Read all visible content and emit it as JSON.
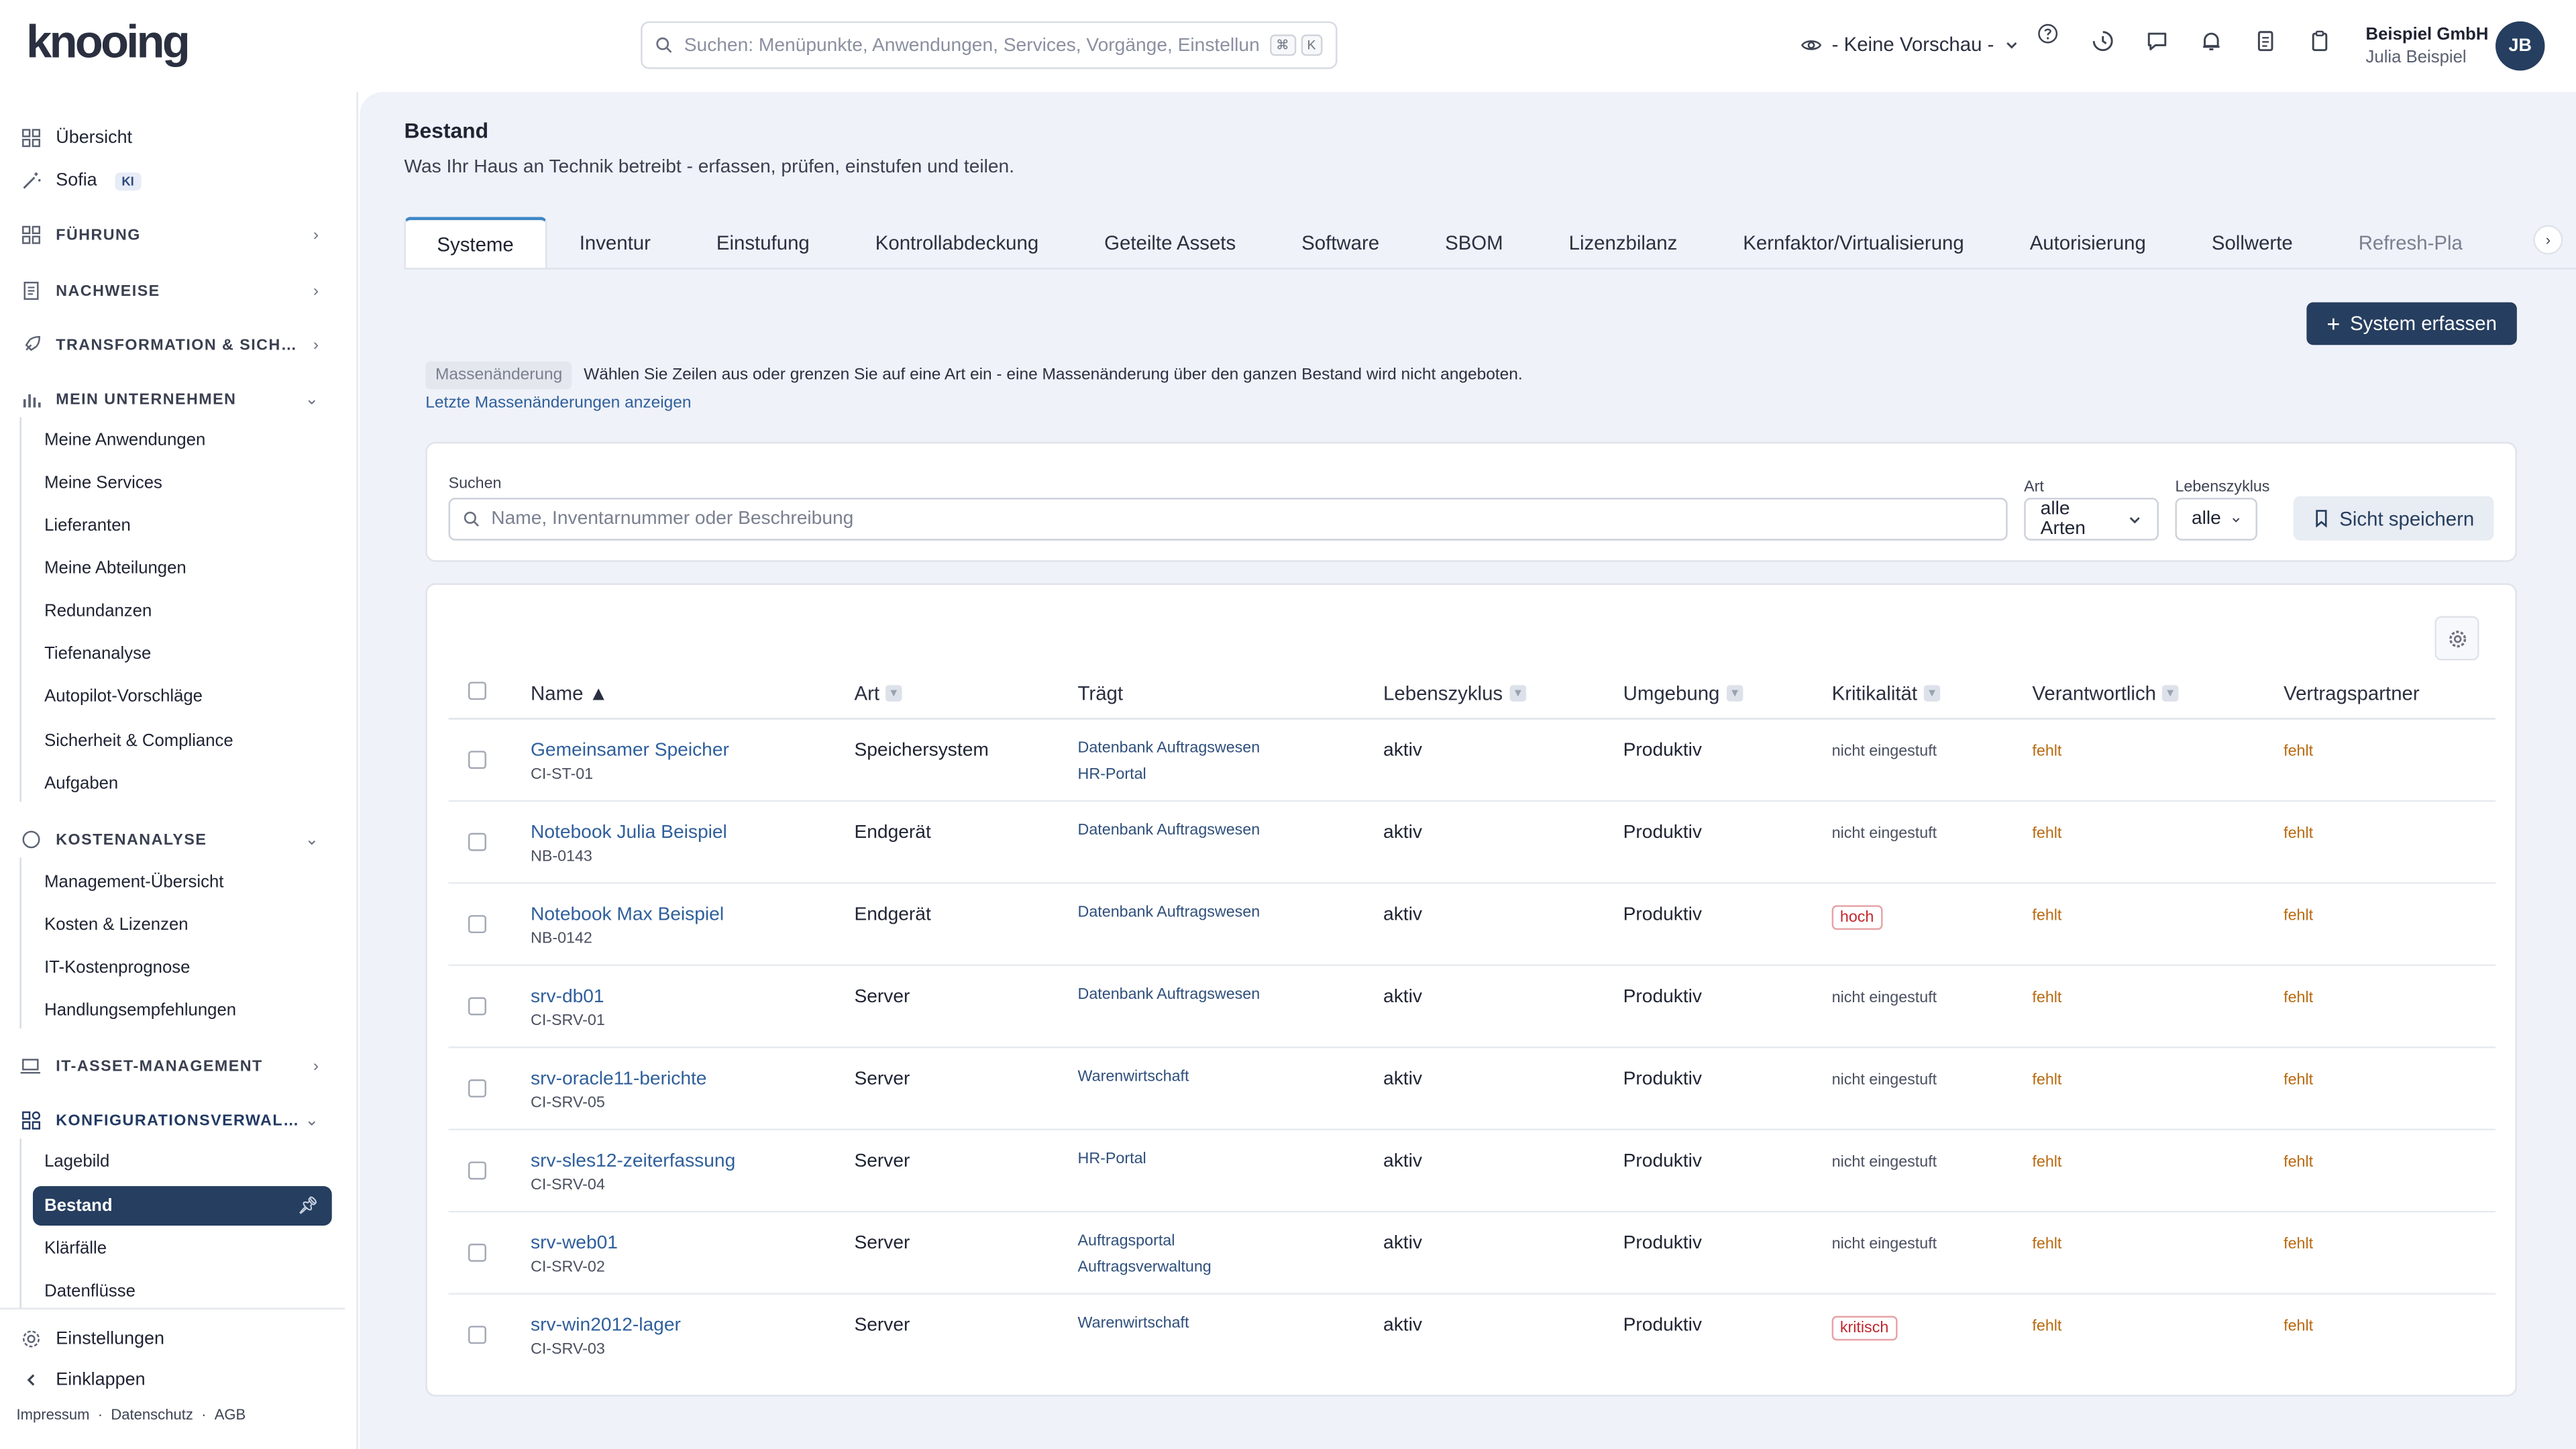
{
  "brand": {
    "logo": "knooing"
  },
  "topbar": {
    "search_placeholder": "Suchen: Menüpunkte, Anwendungen, Services, Vorgänge, Einstellungen",
    "kbd1": "⌘",
    "kbd2": "K",
    "preview": "- Keine Vorschau -",
    "user_company": "Beispiel GmbH",
    "user_name": "Julia Beispiel",
    "avatar": "JB"
  },
  "sidebar": {
    "overview": "Übersicht",
    "sofia": "Sofia",
    "ki": "KI",
    "sections": {
      "fuehrung": "Führung",
      "nachweise": "Nachweise",
      "transformation": "Transformation & Sich…",
      "mein_unternehmen": "Mein Unternehmen",
      "kostenanalyse": "Kostenanalyse",
      "itam": "IT-Asset-Management",
      "konfig": "Konfigurationsverwal…"
    },
    "mein_unternehmen_items": [
      "Meine Anwendungen",
      "Meine Services",
      "Lieferanten",
      "Meine Abteilungen",
      "Redundanzen",
      "Tiefenanalyse",
      "Autopilot-Vorschläge",
      "Sicherheit & Compliance",
      "Aufgaben"
    ],
    "kosten_items": [
      "Management-Übersicht",
      "Kosten & Lizenzen",
      "IT-Kostenprognose",
      "Handlungsempfehlungen"
    ],
    "konfig_items": [
      "Lagebild",
      "Bestand",
      "Klärfälle",
      "Datenflüsse"
    ],
    "settings": "Einstellungen",
    "collapse": "Einklappen",
    "footer": [
      "Impressum",
      "·",
      "Datenschutz",
      "·",
      "AGB"
    ]
  },
  "page": {
    "title": "Bestand",
    "subtitle": "Was Ihr Haus an Technik betreibt - erfassen, prüfen, einstufen und teilen.",
    "tabs": [
      "Systeme",
      "Inventur",
      "Einstufung",
      "Kontrollabdeckung",
      "Geteilte Assets",
      "Software",
      "SBOM",
      "Lizenzbilanz",
      "Kernfaktor/Virtualisierung",
      "Autorisierung",
      "Sollwerte",
      "Refresh-Pla"
    ],
    "add_button": "System erfassen",
    "bulk_tag": "Massenänderung",
    "bulk_text": "Wählen Sie Zeilen aus oder grenzen Sie auf eine Art ein - eine Massenänderung über den ganzen Bestand wird nicht angeboten.",
    "bulk_link": "Letzte Massenänderungen anzeigen"
  },
  "filters": {
    "search_label": "Suchen",
    "search_placeholder": "Name, Inventarnummer oder Beschreibung",
    "art_label": "Art",
    "art_value": "alle Arten",
    "lc_label": "Lebenszyklus",
    "lc_value": "alle",
    "save_view": "Sicht speichern"
  },
  "table": {
    "headers": {
      "name": "Name ▲",
      "art": "Art",
      "traegt": "Trägt",
      "lebenszyklus": "Lebenszyklus",
      "umgebung": "Umgebung",
      "kritikalitaet": "Kritikalität",
      "verantwortlich": "Verantwortlich",
      "vertragspartner": "Vertragspartner"
    },
    "rows": [
      {
        "name": "Gemeinsamer Speicher",
        "id": "CI-ST-01",
        "art": "Speichersystem",
        "traegt": [
          "Datenbank Auftragswesen",
          "HR-Portal"
        ],
        "lc": "aktiv",
        "env": "Produktiv",
        "crit": "nicht eingestuft",
        "crit_flag": false,
        "resp": "fehlt",
        "partner": "fehlt"
      },
      {
        "name": "Notebook Julia Beispiel",
        "id": "NB-0143",
        "art": "Endgerät",
        "traegt": [
          "Datenbank Auftragswesen"
        ],
        "lc": "aktiv",
        "env": "Produktiv",
        "crit": "nicht eingestuft",
        "crit_flag": false,
        "resp": "fehlt",
        "partner": "fehlt"
      },
      {
        "name": "Notebook Max Beispiel",
        "id": "NB-0142",
        "art": "Endgerät",
        "traegt": [
          "Datenbank Auftragswesen"
        ],
        "lc": "aktiv",
        "env": "Produktiv",
        "crit": "hoch",
        "crit_flag": true,
        "resp": "fehlt",
        "partner": "fehlt"
      },
      {
        "name": "srv-db01",
        "id": "CI-SRV-01",
        "art": "Server",
        "traegt": [
          "Datenbank Auftragswesen"
        ],
        "lc": "aktiv",
        "env": "Produktiv",
        "crit": "nicht eingestuft",
        "crit_flag": false,
        "resp": "fehlt",
        "partner": "fehlt"
      },
      {
        "name": "srv-oracle11-berichte",
        "id": "CI-SRV-05",
        "art": "Server",
        "traegt": [
          "Warenwirtschaft"
        ],
        "lc": "aktiv",
        "env": "Produktiv",
        "crit": "nicht eingestuft",
        "crit_flag": false,
        "resp": "fehlt",
        "partner": "fehlt"
      },
      {
        "name": "srv-sles12-zeiterfassung",
        "id": "CI-SRV-04",
        "art": "Server",
        "traegt": [
          "HR-Portal"
        ],
        "lc": "aktiv",
        "env": "Produktiv",
        "crit": "nicht eingestuft",
        "crit_flag": false,
        "resp": "fehlt",
        "partner": "fehlt"
      },
      {
        "name": "srv-web01",
        "id": "CI-SRV-02",
        "art": "Server",
        "traegt": [
          "Auftragsportal",
          "Auftragsverwaltung"
        ],
        "lc": "aktiv",
        "env": "Produktiv",
        "crit": "nicht eingestuft",
        "crit_flag": false,
        "resp": "fehlt",
        "partner": "fehlt"
      },
      {
        "name": "srv-win2012-lager",
        "id": "CI-SRV-03",
        "art": "Server",
        "traegt": [
          "Warenwirtschaft"
        ],
        "lc": "aktiv",
        "env": "Produktiv",
        "crit": "kritisch",
        "crit_flag": true,
        "resp": "fehlt",
        "partner": "fehlt"
      }
    ]
  }
}
